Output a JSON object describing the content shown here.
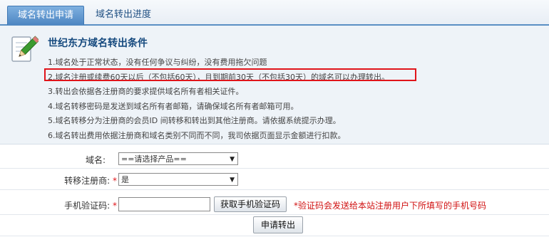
{
  "tabs": [
    {
      "label": "域名转出申请"
    },
    {
      "label": "域名转出进度"
    }
  ],
  "panel": {
    "title": "世纪东方域名转出条件",
    "rules": [
      "1.域名处于正常状态，没有任何争议与纠纷，没有费用拖欠问题",
      "2.域名注册或续费60天以后（不包括60天），且到期前30天（不包括30天）的域名可以办理转出。",
      "3.转出会依据各注册商的要求提供域名所有者相关证件。",
      "4.域名转移密码是发送到域名所有者邮箱，请确保域名所有者邮箱可用。",
      "5.域名转移分为注册商的会员ID 间转移和转出到其他注册商。请依据系统提示办理。",
      "6.域名转出费用依据注册商和域名类别不同而不同，我司依据页面显示金额进行扣款。"
    ]
  },
  "form": {
    "domain_label": "域名:",
    "domain_value": "==请选择产品==",
    "registrar_label": "转移注册商:",
    "registrar_value": "是",
    "phone_label": "手机验证码:",
    "required_mark": "*",
    "get_code_button": "获取手机验证码",
    "hint": "*验证码会发送给本站注册用户下所填写的手机号码",
    "submit_button": "申请转出"
  },
  "colors": {
    "accent": "#4d86c2",
    "highlight_border": "#e0141a",
    "title": "#15497e"
  }
}
